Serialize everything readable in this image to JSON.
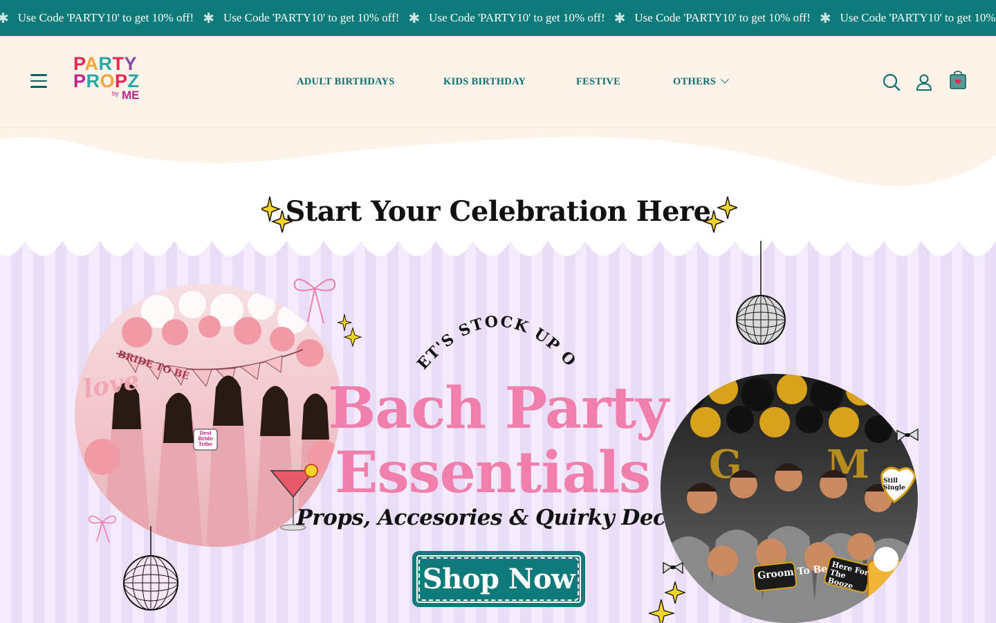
{
  "announcement": {
    "text": "Use Code 'PARTY10' to get 10% off!",
    "repeat_count": 5,
    "background": "#0f7a7a",
    "separator_icon": "asterisk-icon"
  },
  "header": {
    "background": "#fdf3e8",
    "logo": {
      "line1": "PARTY",
      "line2": "PROPZ",
      "sub": "by",
      "brand": "ME"
    },
    "nav": [
      {
        "label": "ADULT BIRTHDAYS"
      },
      {
        "label": "KIDS BIRTHDAY"
      },
      {
        "label": "FESTIVE"
      },
      {
        "label": "OTHERS",
        "has_dropdown": true
      }
    ],
    "icons": [
      "menu-icon",
      "search-icon",
      "account-icon",
      "cart-icon"
    ]
  },
  "section": {
    "title": "Start Your Celebration Here"
  },
  "banner": {
    "arc_text": "LET'S STOCK UP ON",
    "headline_line1": "Bach Party",
    "headline_line2": "Essentials",
    "tagline": "Props, Accesories & Quirky Decor!",
    "cta_label": "Shop Now",
    "left_photo_props": {
      "banner_text": "BRIDE TO BE",
      "balloon_text": "love",
      "sign": "Desi Bride Tribe"
    },
    "right_photo_props": {
      "groom_sign": "Groom To Be",
      "booze_sign": "Here For The Booze",
      "heart_sign": "Still Single"
    },
    "accent_pink": "#f07fac",
    "accent_teal": "#0f7a7a"
  }
}
